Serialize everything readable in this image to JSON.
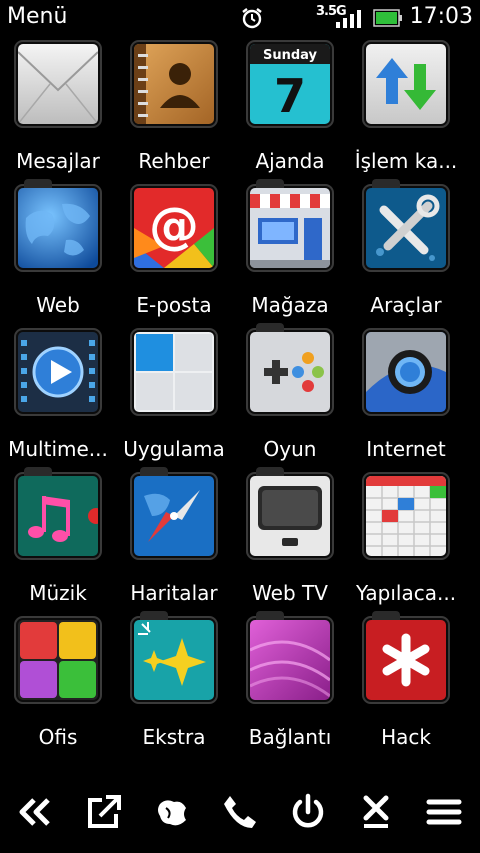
{
  "status": {
    "title": "Menü",
    "time": "17:03",
    "network": "3.5G",
    "icons": [
      "alarm-clock-icon",
      "signal-icon",
      "battery-icon"
    ]
  },
  "apps": [
    {
      "label": "Mesajlar",
      "icon": "envelope-icon"
    },
    {
      "label": "Rehber",
      "icon": "contacts-book-icon"
    },
    {
      "label": "Ajanda",
      "icon": "calendar-icon",
      "day": "Sunday",
      "date": "7"
    },
    {
      "label": "İşlem ka...",
      "icon": "transfer-arrows-icon"
    },
    {
      "label": "Web",
      "icon": "globe-icon"
    },
    {
      "label": "E-posta",
      "icon": "at-sign-icon"
    },
    {
      "label": "Mağaza",
      "icon": "store-icon"
    },
    {
      "label": "Araçlar",
      "icon": "tools-icon"
    },
    {
      "label": "Multime...",
      "icon": "play-film-icon"
    },
    {
      "label": "Uygulama",
      "icon": "apps-grid-icon"
    },
    {
      "label": "Oyun",
      "icon": "gamepad-icon"
    },
    {
      "label": "Internet",
      "icon": "internet-ring-icon"
    },
    {
      "label": "Müzik",
      "icon": "music-notes-icon"
    },
    {
      "label": "Haritalar",
      "icon": "compass-icon"
    },
    {
      "label": "Web TV",
      "icon": "tv-icon"
    },
    {
      "label": "Yapılaca...",
      "icon": "todo-grid-icon"
    },
    {
      "label": "Ofis",
      "icon": "office-squares-icon"
    },
    {
      "label": "Ekstra",
      "icon": "sparkle-stars-icon"
    },
    {
      "label": "Bağlantı",
      "icon": "connection-folder-icon"
    },
    {
      "label": "Hack",
      "icon": "asterisk-icon"
    }
  ],
  "bottombar": [
    "back-double-chevron-icon",
    "open-external-icon",
    "globe-map-icon",
    "phone-icon",
    "power-icon",
    "close-x-icon",
    "menu-lines-icon"
  ],
  "colors": {
    "background": "#000000",
    "text": "#ffffff",
    "battery": "#2fbf3a"
  }
}
